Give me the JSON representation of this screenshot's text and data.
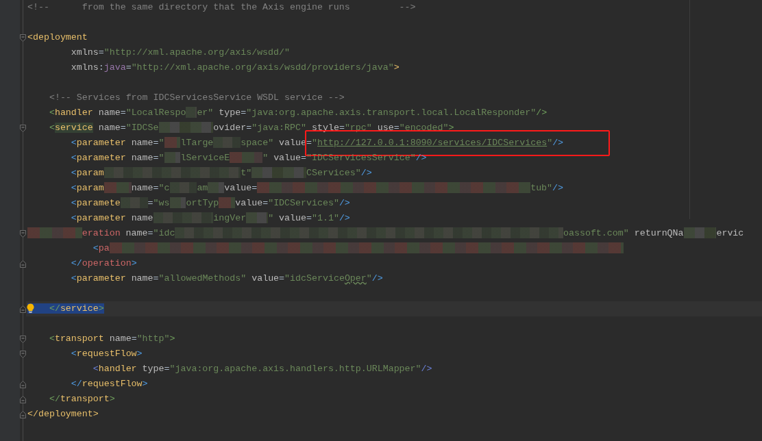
{
  "editor": {
    "lines": [
      {
        "kind": "code",
        "tokens": [
          {
            "kind": "comment",
            "text": "<!--      from the same directory that the Axis engine runs         -->"
          }
        ]
      },
      {
        "kind": "blank"
      },
      {
        "kind": "code",
        "fold_start": true,
        "tokens": [
          {
            "kind": "brk0",
            "text": "<"
          },
          {
            "kind": "tag",
            "text": "deployment"
          }
        ]
      },
      {
        "kind": "code",
        "tokens": [
          {
            "kind": "attr",
            "text": "        xmlns"
          },
          {
            "kind": "eq",
            "text": "="
          },
          {
            "kind": "str",
            "text": "\"http://xml.apache.org/axis/wsdd/\""
          }
        ]
      },
      {
        "kind": "code",
        "tokens": [
          {
            "kind": "attr",
            "text": "        xmlns"
          },
          {
            "kind": "eq",
            "text": ":"
          },
          {
            "kind": "ns",
            "text": "java"
          },
          {
            "kind": "eq",
            "text": "="
          },
          {
            "kind": "str",
            "text": "\"http://xml.apache.org/axis/wsdd/providers/java\""
          },
          {
            "kind": "brk0",
            "text": ">"
          }
        ]
      },
      {
        "kind": "blank"
      },
      {
        "kind": "code",
        "tokens": [
          {
            "kind": "comment",
            "text": "    <!-- Services from IDCServicesService WSDL service -->"
          }
        ]
      },
      {
        "kind": "code",
        "tokens": [
          {
            "kind": "brk1",
            "text": "    <"
          },
          {
            "kind": "tag",
            "text": "handler"
          },
          {
            "kind": "attr",
            "text": " name"
          },
          {
            "kind": "eq",
            "text": "="
          },
          {
            "kind": "str",
            "text": "\"LocalRespo"
          },
          {
            "kind": "blur"
          },
          {
            "kind": "str",
            "text": "er\""
          },
          {
            "kind": "attr",
            "text": " type"
          },
          {
            "kind": "eq",
            "text": "="
          },
          {
            "kind": "str",
            "text": "\"java:org.apache.axis.transport.local.LocalResponder\""
          },
          {
            "kind": "brk1",
            "text": "/>"
          }
        ]
      },
      {
        "kind": "code",
        "fold_start": true,
        "tokens": [
          {
            "kind": "brk1",
            "text": "    <"
          },
          {
            "kind": "tag",
            "text": "service",
            "matched": true
          },
          {
            "kind": "attr",
            "text": " name"
          },
          {
            "kind": "eq",
            "text": "="
          },
          {
            "kind": "str",
            "text": "\"IDCSe"
          },
          {
            "kind": "blur"
          },
          {
            "kind": "attr",
            "text": "ovider"
          },
          {
            "kind": "eq",
            "text": "="
          },
          {
            "kind": "str",
            "text": "\"java:RPC\""
          },
          {
            "kind": "attr",
            "text": " style"
          },
          {
            "kind": "eq",
            "text": "="
          },
          {
            "kind": "str",
            "text": "\"rpc\""
          },
          {
            "kind": "attr",
            "text": " use"
          },
          {
            "kind": "eq",
            "text": "="
          },
          {
            "kind": "str",
            "text": "\"encoded\""
          },
          {
            "kind": "brk1",
            "text": ">"
          }
        ]
      },
      {
        "kind": "code",
        "tokens": [
          {
            "kind": "brk2",
            "text": "        <"
          },
          {
            "kind": "tag",
            "text": "parameter"
          },
          {
            "kind": "attr",
            "text": " name"
          },
          {
            "kind": "eq",
            "text": "="
          },
          {
            "kind": "str",
            "text": "\""
          },
          {
            "kind": "blur"
          },
          {
            "kind": "str",
            "text": "lTarge"
          },
          {
            "kind": "blur"
          },
          {
            "kind": "str",
            "text": "space\""
          },
          {
            "kind": "attr",
            "text": " value"
          },
          {
            "kind": "eq",
            "text": "=",
            "boxed": true
          },
          {
            "kind": "str",
            "text": "\"",
            "boxed": true
          },
          {
            "kind": "link",
            "text": "http://127.0.0.1:8090/services/IDCServices",
            "boxed": true
          },
          {
            "kind": "str",
            "text": "\"",
            "boxed": true
          },
          {
            "kind": "brk2",
            "text": "/>",
            "boxed": true
          }
        ]
      },
      {
        "kind": "code",
        "tokens": [
          {
            "kind": "brk2",
            "text": "        <"
          },
          {
            "kind": "tag",
            "text": "parameter"
          },
          {
            "kind": "attr",
            "text": " name"
          },
          {
            "kind": "eq",
            "text": "="
          },
          {
            "kind": "str",
            "text": "\""
          },
          {
            "kind": "blur"
          },
          {
            "kind": "str",
            "text": "lServiceE"
          },
          {
            "kind": "blur"
          },
          {
            "kind": "str",
            "text": "\""
          },
          {
            "kind": "attr",
            "text": " value"
          },
          {
            "kind": "eq",
            "text": "="
          },
          {
            "kind": "str",
            "text": "\"IDCServicesService\""
          },
          {
            "kind": "brk2",
            "text": "/>"
          }
        ]
      },
      {
        "kind": "code",
        "tokens": [
          {
            "kind": "brk2",
            "text": "        <"
          },
          {
            "kind": "tag",
            "text": "param"
          },
          {
            "kind": "blur"
          },
          {
            "kind": "str",
            "text": "t\""
          },
          {
            "kind": "blur"
          },
          {
            "kind": "str",
            "text": "CServices\""
          },
          {
            "kind": "brk2",
            "text": "/>"
          }
        ]
      },
      {
        "kind": "code",
        "tokens": [
          {
            "kind": "brk2",
            "text": "        <"
          },
          {
            "kind": "tag",
            "text": "param"
          },
          {
            "kind": "blur"
          },
          {
            "kind": "attr",
            "text": "name"
          },
          {
            "kind": "eq",
            "text": "="
          },
          {
            "kind": "str",
            "text": "\"c"
          },
          {
            "kind": "blur"
          },
          {
            "kind": "str",
            "text": "am"
          },
          {
            "kind": "blur"
          },
          {
            "kind": "attr",
            "text": "value"
          },
          {
            "kind": "eq",
            "text": "="
          },
          {
            "kind": "blur"
          },
          {
            "kind": "str",
            "text": "tub\""
          },
          {
            "kind": "brk2",
            "text": "/>"
          }
        ]
      },
      {
        "kind": "code",
        "tokens": [
          {
            "kind": "brk2",
            "text": "        <"
          },
          {
            "kind": "tag",
            "text": "paramete"
          },
          {
            "kind": "blur"
          },
          {
            "kind": "eq",
            "text": "="
          },
          {
            "kind": "str",
            "text": "\"ws"
          },
          {
            "kind": "blur"
          },
          {
            "kind": "str",
            "text": "ortTyp"
          },
          {
            "kind": "blur"
          },
          {
            "kind": "attr",
            "text": "value"
          },
          {
            "kind": "eq",
            "text": "="
          },
          {
            "kind": "str",
            "text": "\"IDCServices\""
          },
          {
            "kind": "brk2",
            "text": "/>"
          }
        ]
      },
      {
        "kind": "code",
        "tokens": [
          {
            "kind": "brk2",
            "text": "        <"
          },
          {
            "kind": "tag",
            "text": "parameter"
          },
          {
            "kind": "attr",
            "text": " name"
          },
          {
            "kind": "blur"
          },
          {
            "kind": "str",
            "text": "ingVer"
          },
          {
            "kind": "blur"
          },
          {
            "kind": "str",
            "text": "\""
          },
          {
            "kind": "attr",
            "text": " value"
          },
          {
            "kind": "eq",
            "text": "="
          },
          {
            "kind": "str",
            "text": "\"1.1\""
          },
          {
            "kind": "brk2",
            "text": "/>"
          }
        ]
      },
      {
        "kind": "code",
        "fold_start": true,
        "tokens": [
          {
            "kind": "blur"
          },
          {
            "kind": "optag",
            "text": "eration"
          },
          {
            "kind": "attr",
            "text": " name"
          },
          {
            "kind": "eq",
            "text": "="
          },
          {
            "kind": "str",
            "text": "\"idc"
          },
          {
            "kind": "blur"
          },
          {
            "kind": "str",
            "text": "oassoft.com\""
          },
          {
            "kind": "attr",
            "text": " returnQNa"
          },
          {
            "kind": "blur"
          },
          {
            "kind": "attr",
            "text": "ervic"
          }
        ]
      },
      {
        "kind": "code",
        "tokens": [
          {
            "kind": "brk2",
            "text": "            <"
          },
          {
            "kind": "optag",
            "text": "pa"
          },
          {
            "kind": "blur"
          }
        ]
      },
      {
        "kind": "code",
        "fold_end": true,
        "tokens": [
          {
            "kind": "brk2",
            "text": "        </"
          },
          {
            "kind": "optag",
            "text": "operation"
          },
          {
            "kind": "brk2",
            "text": ">"
          }
        ]
      },
      {
        "kind": "code",
        "tokens": [
          {
            "kind": "brk2",
            "text": "        <"
          },
          {
            "kind": "tag",
            "text": "parameter"
          },
          {
            "kind": "attr",
            "text": " name"
          },
          {
            "kind": "eq",
            "text": "="
          },
          {
            "kind": "str",
            "text": "\"allowedMethods\""
          },
          {
            "kind": "attr",
            "text": " value"
          },
          {
            "kind": "eq",
            "text": "="
          },
          {
            "kind": "str",
            "text": "\"idcService"
          },
          {
            "kind": "str",
            "text": "Oper",
            "typo": true
          },
          {
            "kind": "str",
            "text": "\""
          },
          {
            "kind": "brk2",
            "text": "/>"
          }
        ]
      },
      {
        "kind": "blank"
      },
      {
        "kind": "code",
        "fold_end": true,
        "current": true,
        "intention": true,
        "tokens": [
          {
            "kind": "brk1",
            "text": "    </",
            "highlighted": true
          },
          {
            "kind": "tag",
            "text": "service",
            "highlighted": true
          },
          {
            "kind": "brk1",
            "text": ">",
            "highlighted": true
          }
        ]
      },
      {
        "kind": "blank"
      },
      {
        "kind": "code",
        "fold_start": true,
        "tokens": [
          {
            "kind": "brk1",
            "text": "    <"
          },
          {
            "kind": "tag",
            "text": "transport"
          },
          {
            "kind": "attr",
            "text": " name"
          },
          {
            "kind": "eq",
            "text": "="
          },
          {
            "kind": "str",
            "text": "\"http\""
          },
          {
            "kind": "brk1",
            "text": ">"
          }
        ]
      },
      {
        "kind": "code",
        "fold_start": true,
        "tokens": [
          {
            "kind": "brk2",
            "text": "        <"
          },
          {
            "kind": "tag",
            "text": "requestFlow"
          },
          {
            "kind": "brk2",
            "text": ">"
          }
        ]
      },
      {
        "kind": "code",
        "tokens": [
          {
            "kind": "brk3",
            "text": "            <"
          },
          {
            "kind": "tag",
            "text": "handler"
          },
          {
            "kind": "attr",
            "text": " type"
          },
          {
            "kind": "eq",
            "text": "="
          },
          {
            "kind": "str",
            "text": "\"java:org.apache.axis.handlers.http.URLMapper\""
          },
          {
            "kind": "brk3",
            "text": "/>"
          }
        ]
      },
      {
        "kind": "code",
        "fold_end": true,
        "tokens": [
          {
            "kind": "brk2",
            "text": "        </"
          },
          {
            "kind": "tag",
            "text": "requestFlow"
          },
          {
            "kind": "brk2",
            "text": ">"
          }
        ]
      },
      {
        "kind": "code",
        "fold_end": true,
        "tokens": [
          {
            "kind": "brk1",
            "text": "    </"
          },
          {
            "kind": "tag",
            "text": "transport"
          },
          {
            "kind": "brk1",
            "text": ">"
          }
        ]
      },
      {
        "kind": "code",
        "fold_end": true,
        "tokens": [
          {
            "kind": "brk0",
            "text": "</"
          },
          {
            "kind": "tag",
            "text": "deployment"
          },
          {
            "kind": "brk0",
            "text": ">"
          }
        ]
      }
    ]
  }
}
